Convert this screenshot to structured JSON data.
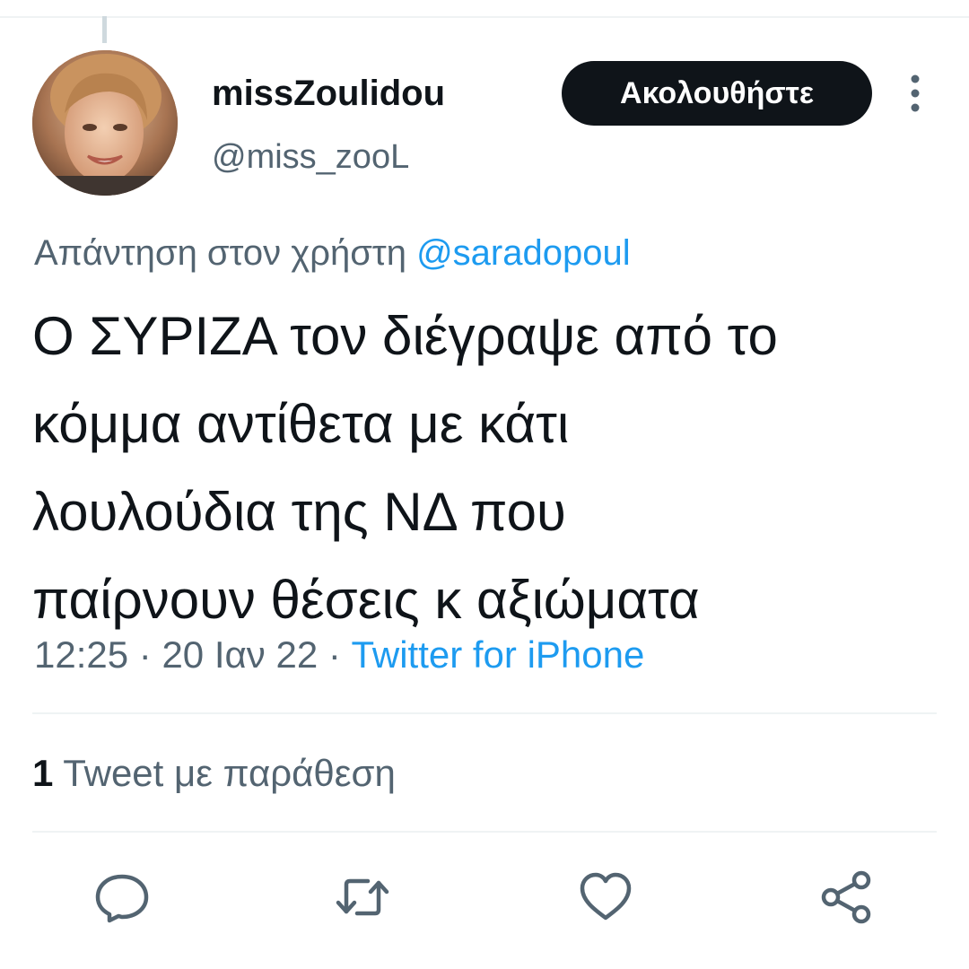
{
  "author": {
    "display_name": "missZoulidou",
    "handle": "@miss_zooL",
    "avatar_icon": "profile-photo"
  },
  "follow_button": {
    "label": "Ακολουθήστε"
  },
  "more_icon": "vertical-ellipsis",
  "reply_context": {
    "prefix": "Απάντηση στον χρήστη",
    "mention": "@saradopoul"
  },
  "tweet": {
    "lines": [
      "Ο ΣΥΡΙΖΑ τον διέγραψε από το",
      "κόμμα αντίθετα με κάτι",
      "λουλούδια της ΝΔ που",
      "παίρνουν θέσεις κ αξιώματα"
    ],
    "time": "12:25",
    "separator": "·",
    "date": "20 Ιαν 22",
    "source": "Twitter for iPhone"
  },
  "stats": {
    "quote_count": "1",
    "quote_label": "Tweet με παράθεση"
  },
  "actions": {
    "reply_icon": "comment-icon",
    "retweet_icon": "retweet-icon",
    "like_icon": "heart-icon",
    "share_icon": "share-icon"
  },
  "colors": {
    "text": "#0f1419",
    "secondary": "#536471",
    "accent": "#1d9bf0",
    "button_bg": "#0f1419",
    "divider": "#eff3f4"
  }
}
